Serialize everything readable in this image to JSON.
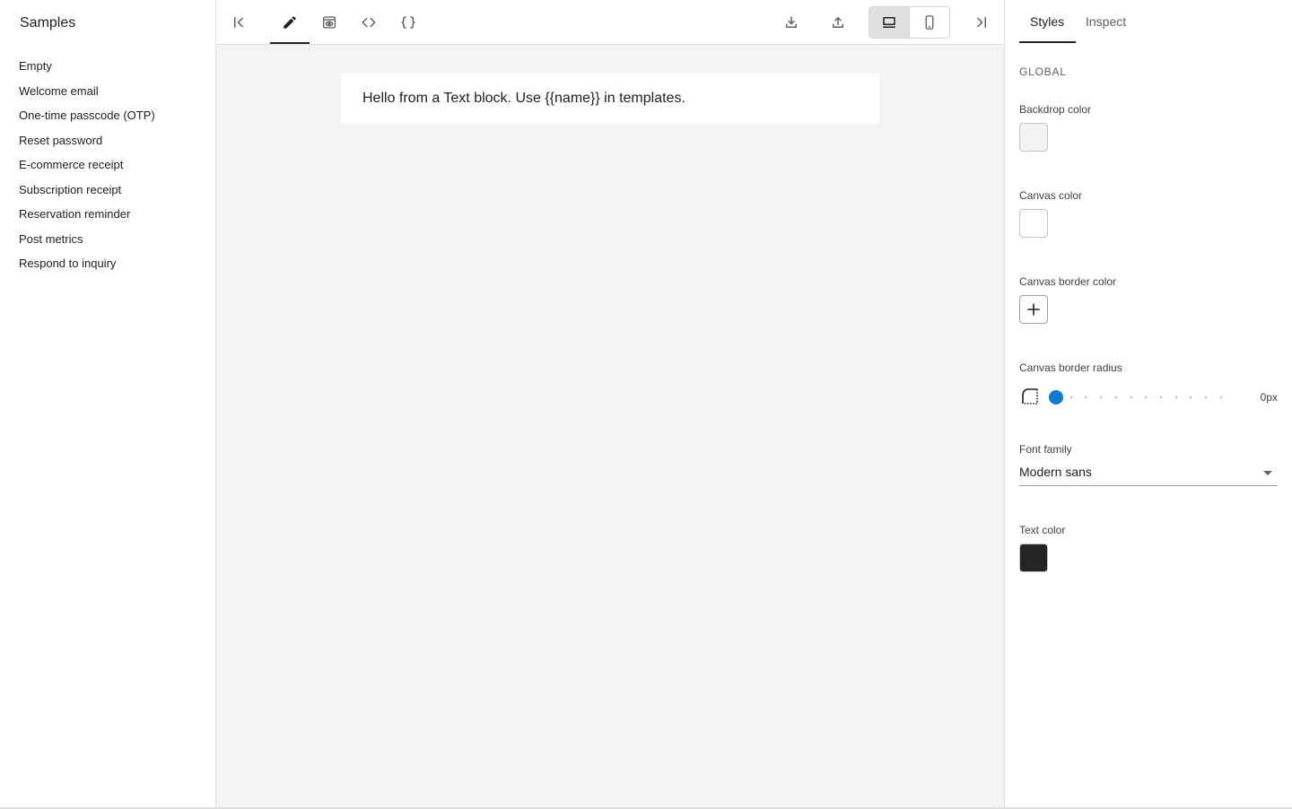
{
  "sidebar": {
    "title": "Samples",
    "items": [
      {
        "label": "Empty"
      },
      {
        "label": "Welcome email"
      },
      {
        "label": "One-time passcode (OTP)"
      },
      {
        "label": "Reset password"
      },
      {
        "label": "E-commerce receipt"
      },
      {
        "label": "Subscription receipt"
      },
      {
        "label": "Reservation reminder"
      },
      {
        "label": "Post metrics"
      },
      {
        "label": "Respond to inquiry"
      }
    ]
  },
  "toolbar": {
    "icons": [
      "collapse-left-icon",
      "edit-pencil-icon",
      "preview-eye-icon",
      "html-code-icon",
      "json-braces-icon",
      "download-icon",
      "upload-icon",
      "desktop-icon",
      "mobile-icon",
      "collapse-right-icon"
    ],
    "active_tab": "edit",
    "active_view": "desktop"
  },
  "canvas": {
    "text_block": "Hello from a Text block. Use {{name}} in templates."
  },
  "inspector": {
    "tabs": [
      {
        "label": "Styles"
      },
      {
        "label": "Inspect"
      }
    ],
    "section": "GLOBAL",
    "backdrop_color": {
      "label": "Backdrop color",
      "value": "#F1F3F5"
    },
    "canvas_color": {
      "label": "Canvas color",
      "value": "#FFFFFF"
    },
    "canvas_border_color": {
      "label": "Canvas border color"
    },
    "canvas_border_radius": {
      "label": "Canvas border radius",
      "value": "0px",
      "level": 0
    },
    "font_family": {
      "label": "Font family",
      "value": "Modern sans"
    },
    "text_color": {
      "label": "Text color",
      "value": "#242424"
    }
  },
  "colors": {
    "accent": "#0F7AD4",
    "canvas_background": "#F4F4F4"
  }
}
